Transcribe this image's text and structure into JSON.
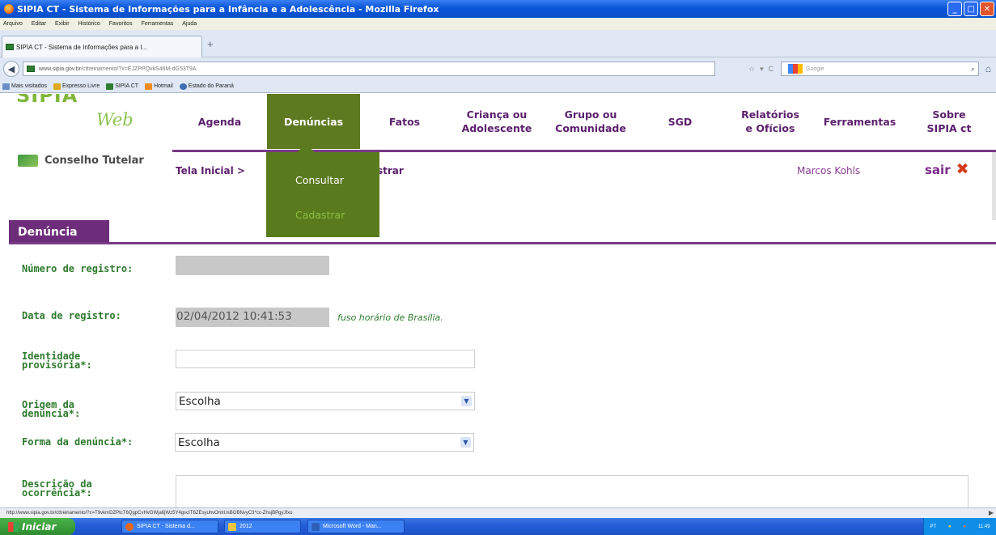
{
  "window": {
    "title": "SIPIA CT - Sistema de Informações para a Infância e a Adolescência - Mozilla Firefox"
  },
  "menubar": [
    "Arquivo",
    "Editar",
    "Exibir",
    "Histórico",
    "Favoritos",
    "Ferramentas",
    "Ajuda"
  ],
  "tab": {
    "title": "SIPIA CT - Sistema de Informações para a I..."
  },
  "url": {
    "domain": "www.sipia.gov.br",
    "path": "/cttreinamento/?x=EJZPPQvkS46M-dG53T9A"
  },
  "search": {
    "engine_label": "Google"
  },
  "bookmarks": [
    "Mais visitados",
    "Expresso Livre",
    "SIPIA CT",
    "Hotmail",
    "Estado do Paraná"
  ],
  "site": {
    "logo_web": "Web",
    "org_name": "Conselho Tutelar"
  },
  "nav": [
    {
      "label": "Agenda"
    },
    {
      "label": "Denúncias",
      "active": true
    },
    {
      "label": "Fatos"
    },
    {
      "label": "Criança ou\nAdolescente"
    },
    {
      "label": "Grupo ou\nComunidade"
    },
    {
      "label": "SGD"
    },
    {
      "label": "Relatórios\ne Ofícios"
    },
    {
      "label": "Ferramentas"
    },
    {
      "label": "Sobre\nSIPIA ct"
    }
  ],
  "breadcrumb": {
    "home": "Tela Inicial",
    "tail": "strar"
  },
  "dropdown": {
    "items": [
      "Consultar",
      "Cadastrar"
    ]
  },
  "user": {
    "name": "Marcos Kohls",
    "logout": "sair"
  },
  "section": {
    "title": "Denúncia"
  },
  "form": {
    "numero_label": "Número de registro:",
    "data_label": "Data de registro:",
    "data_value": "02/04/2012 10:41:53",
    "fuso": "fuso horário de Brasília.",
    "identidade_label": "Identidade provisória*:",
    "origem_label": "Origem da denuncia*:",
    "origem_value": "Escolha",
    "forma_label": "Forma da denúncia*:",
    "forma_value": "Escolha",
    "descricao_label": "Descrição da ocorrência*:"
  },
  "statusbar": {
    "text": "http://www.sipia.gov.br/cttreinamento/?c=T9vkmDZPtcT6QgpCvHvGWja6jWz5Y4gscIT6ZEsyuhvOmtUsBGBNvyC3*cc-ZhsjBPgyJfxo"
  },
  "taskbar": {
    "start": "Iniciar",
    "tasks": [
      "SIPIA CT - Sistema d...",
      "2012",
      "Microsoft Word - Man..."
    ],
    "tray": {
      "lang": "PT",
      "time": "11:49"
    }
  }
}
